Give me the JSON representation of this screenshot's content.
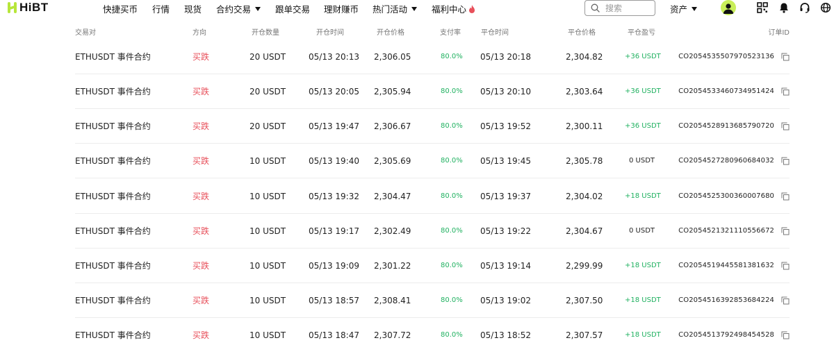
{
  "brand": {
    "logo_text": "HiBT",
    "accent": "#b7e63a"
  },
  "nav": {
    "items": [
      {
        "label": "快捷买币",
        "dropdown": false
      },
      {
        "label": "行情",
        "dropdown": false
      },
      {
        "label": "现货",
        "dropdown": false
      },
      {
        "label": "合约交易",
        "dropdown": true
      },
      {
        "label": "跟单交易",
        "dropdown": false
      },
      {
        "label": "理财赚币",
        "dropdown": false
      },
      {
        "label": "热门活动",
        "dropdown": true
      },
      {
        "label": "福利中心",
        "dropdown": false,
        "icon": "fire-icon"
      }
    ]
  },
  "search": {
    "placeholder": "搜索"
  },
  "header_right": {
    "assets_label": "资产",
    "icons": [
      "qr-code-icon",
      "bell-icon",
      "headset-icon",
      "globe-icon"
    ]
  },
  "table": {
    "headers": [
      "交易对",
      "方向",
      "开仓数量",
      "开仓时间",
      "开仓价格",
      "支付率",
      "平仓时间",
      "平仓价格",
      "平仓盈亏",
      "订单ID"
    ],
    "rows": [
      {
        "pair": "ETHUSDT 事件合约",
        "direction": "买跌",
        "amount": "20 USDT",
        "open_time": "05/13 20:13",
        "open_price": "2,306.05",
        "rate": "80.0%",
        "close_time": "05/13 20:18",
        "close_price": "2,304.82",
        "pnl": "+36 USDT",
        "order_id": "CO2054535507970523136"
      },
      {
        "pair": "ETHUSDT 事件合约",
        "direction": "买跌",
        "amount": "20 USDT",
        "open_time": "05/13 20:05",
        "open_price": "2,305.94",
        "rate": "80.0%",
        "close_time": "05/13 20:10",
        "close_price": "2,303.64",
        "pnl": "+36 USDT",
        "order_id": "CO2054533460734951424"
      },
      {
        "pair": "ETHUSDT 事件合约",
        "direction": "买跌",
        "amount": "20 USDT",
        "open_time": "05/13 19:47",
        "open_price": "2,306.67",
        "rate": "80.0%",
        "close_time": "05/13 19:52",
        "close_price": "2,300.11",
        "pnl": "+36 USDT",
        "order_id": "CO2054528913685790720"
      },
      {
        "pair": "ETHUSDT 事件合约",
        "direction": "买跌",
        "amount": "10 USDT",
        "open_time": "05/13 19:40",
        "open_price": "2,305.69",
        "rate": "80.0%",
        "close_time": "05/13 19:45",
        "close_price": "2,305.78",
        "pnl": "0 USDT",
        "order_id": "CO2054527280960684032"
      },
      {
        "pair": "ETHUSDT 事件合约",
        "direction": "买跌",
        "amount": "10 USDT",
        "open_time": "05/13 19:32",
        "open_price": "2,304.47",
        "rate": "80.0%",
        "close_time": "05/13 19:37",
        "close_price": "2,304.02",
        "pnl": "+18 USDT",
        "order_id": "CO2054525300360007680"
      },
      {
        "pair": "ETHUSDT 事件合约",
        "direction": "买跌",
        "amount": "10 USDT",
        "open_time": "05/13 19:17",
        "open_price": "2,302.49",
        "rate": "80.0%",
        "close_time": "05/13 19:22",
        "close_price": "2,304.67",
        "pnl": "0 USDT",
        "order_id": "CO2054521321110556672"
      },
      {
        "pair": "ETHUSDT 事件合约",
        "direction": "买跌",
        "amount": "10 USDT",
        "open_time": "05/13 19:09",
        "open_price": "2,301.22",
        "rate": "80.0%",
        "close_time": "05/13 19:14",
        "close_price": "2,299.99",
        "pnl": "+18 USDT",
        "order_id": "CO2054519445581381632"
      },
      {
        "pair": "ETHUSDT 事件合约",
        "direction": "买跌",
        "amount": "10 USDT",
        "open_time": "05/13 18:57",
        "open_price": "2,308.41",
        "rate": "80.0%",
        "close_time": "05/13 19:02",
        "close_price": "2,307.50",
        "pnl": "+18 USDT",
        "order_id": "CO2054516392853684224"
      },
      {
        "pair": "ETHUSDT 事件合约",
        "direction": "买跌",
        "amount": "10 USDT",
        "open_time": "05/13 18:47",
        "open_price": "2,307.72",
        "rate": "80.0%",
        "close_time": "05/13 18:52",
        "close_price": "2,307.57",
        "pnl": "+18 USDT",
        "order_id": "CO2054513792498454528"
      }
    ]
  },
  "colors": {
    "sell": "#e8505b",
    "profit": "#20b160"
  }
}
